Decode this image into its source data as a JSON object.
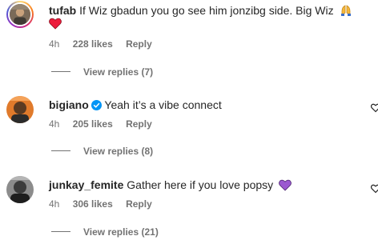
{
  "colors": {
    "text": "#262626",
    "secondary": "#737373",
    "verified": "#0095f6",
    "heart_red": "#ed1c3c",
    "heart_purple": "#9b59d0"
  },
  "comments": [
    {
      "username": "tufab",
      "text": "If Wiz gbadun you go see him jonzibg side. Big Wiz",
      "emojis": [
        "folded-hands-emoji",
        "red-heart-emoji"
      ],
      "time": "4h",
      "likes": "228 likes",
      "reply_label": "Reply",
      "view_replies": "View replies (7)",
      "verified": false,
      "story_ring": true
    },
    {
      "username": "bigiano",
      "text": "Yeah it’s a vibe connect",
      "emojis": [],
      "time": "4h",
      "likes": "205 likes",
      "reply_label": "Reply",
      "view_replies": "View replies (8)",
      "verified": true,
      "story_ring": false
    },
    {
      "username": "junkay_femite",
      "text": "Gather here if you love popsy",
      "emojis": [
        "purple-heart-emoji"
      ],
      "time": "4h",
      "likes": "306 likes",
      "reply_label": "Reply",
      "view_replies": "View replies (21)",
      "verified": false,
      "story_ring": false
    }
  ]
}
